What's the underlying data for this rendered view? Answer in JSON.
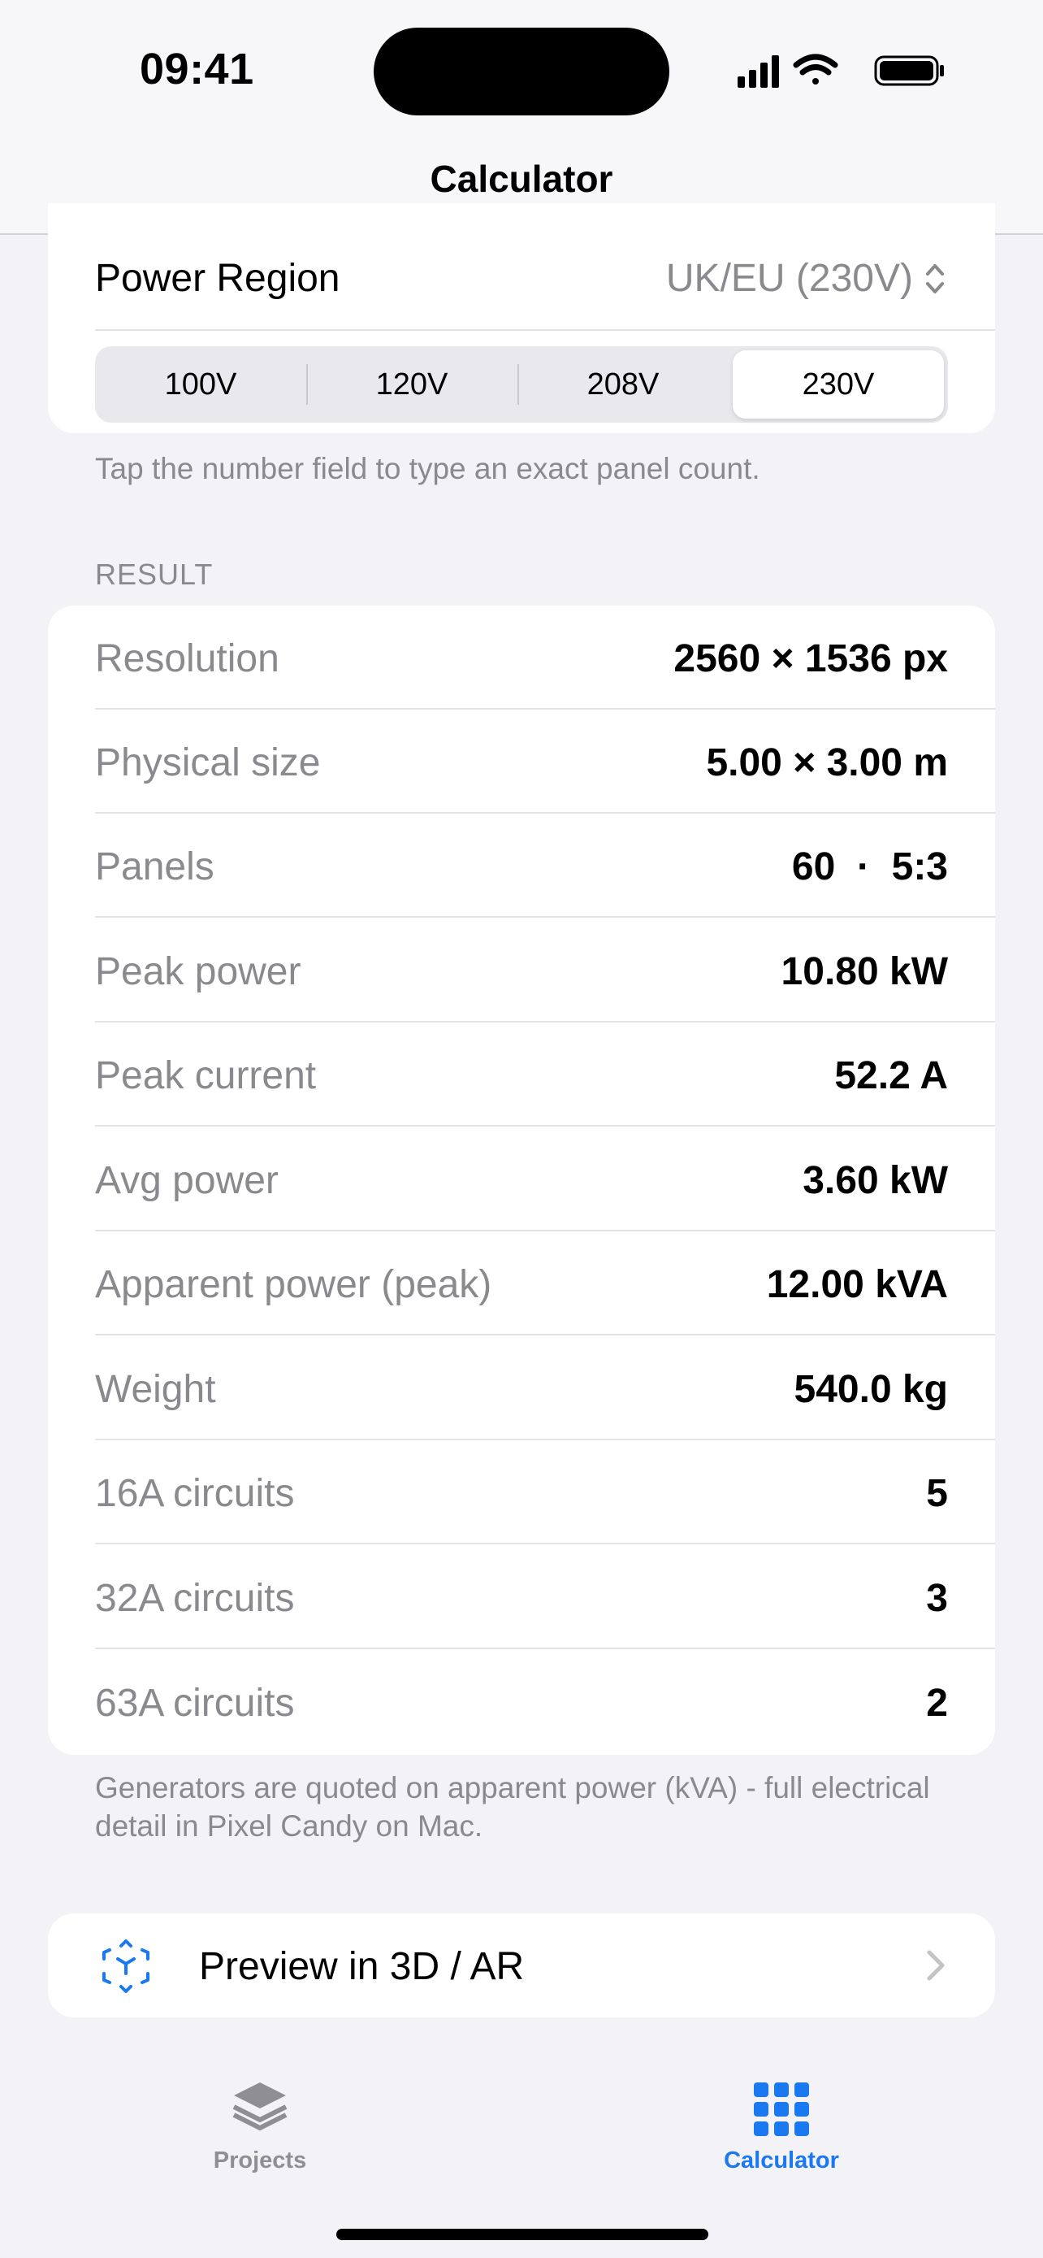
{
  "status_bar": {
    "time": "09:41"
  },
  "nav": {
    "title": "Calculator"
  },
  "power_region": {
    "label": "Power Region",
    "value": "UK/EU (230V)",
    "segments": [
      "100V",
      "120V",
      "208V",
      "230V"
    ],
    "selected_segment": "230V",
    "hint": "Tap the number field to type an exact panel count."
  },
  "result": {
    "section_title": "RESULT",
    "rows": [
      {
        "label": "Resolution",
        "value": "2560 × 1536 px"
      },
      {
        "label": "Physical size",
        "value": "5.00 × 3.00 m"
      },
      {
        "label": "Panels",
        "value": "60  ·  5:3"
      },
      {
        "label": "Peak power",
        "value": "10.80 kW"
      },
      {
        "label": "Peak current",
        "value": "52.2 A"
      },
      {
        "label": "Avg power",
        "value": "3.60 kW"
      },
      {
        "label": "Apparent power (peak)",
        "value": "12.00 kVA"
      },
      {
        "label": "Weight",
        "value": "540.0 kg"
      },
      {
        "label": "16A circuits",
        "value": "5"
      },
      {
        "label": "32A circuits",
        "value": "3"
      },
      {
        "label": "63A circuits",
        "value": "2"
      }
    ],
    "footer": "Generators are quoted on apparent power (kVA) - full electrical detail in Pixel Candy on Mac."
  },
  "preview": {
    "label": "Preview in 3D / AR",
    "icon": "ar-cube-icon"
  },
  "tabs": [
    {
      "label": "Projects",
      "icon": "layers-icon",
      "active": false
    },
    {
      "label": "Calculator",
      "icon": "grid-icon",
      "active": true
    }
  ],
  "colors": {
    "accent": "#1a78f0",
    "secondary_text": "#8a8a8e",
    "background": "#f2f2f7"
  }
}
